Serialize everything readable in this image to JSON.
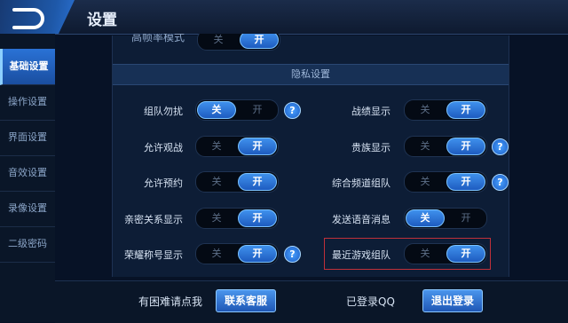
{
  "header": {
    "title": "设置"
  },
  "sidebar": {
    "items": [
      {
        "label": "基础设置",
        "active": true
      },
      {
        "label": "操作设置",
        "active": false
      },
      {
        "label": "界面设置",
        "active": false
      },
      {
        "label": "音效设置",
        "active": false
      },
      {
        "label": "录像设置",
        "active": false
      },
      {
        "label": "二级密码",
        "active": false
      }
    ]
  },
  "partial_row": {
    "label": "高帧率模式",
    "off": "关",
    "on": "开",
    "state": "on"
  },
  "section": {
    "title": "隐私设置"
  },
  "settings": {
    "left": [
      {
        "label": "组队勿扰",
        "off": "关",
        "on": "开",
        "state": "off",
        "help": "?"
      },
      {
        "label": "允许观战",
        "off": "关",
        "on": "开",
        "state": "on"
      },
      {
        "label": "允许预约",
        "off": "关",
        "on": "开",
        "state": "on"
      },
      {
        "label": "亲密关系显示",
        "off": "关",
        "on": "开",
        "state": "on"
      },
      {
        "label": "荣耀称号显示",
        "off": "关",
        "on": "开",
        "state": "on",
        "help": "?"
      }
    ],
    "right": [
      {
        "label": "战绩显示",
        "off": "关",
        "on": "开",
        "state": "on"
      },
      {
        "label": "贵族显示",
        "off": "关",
        "on": "开",
        "state": "on",
        "help": "?"
      },
      {
        "label": "综合频道组队",
        "off": "关",
        "on": "开",
        "state": "on",
        "help": "?"
      },
      {
        "label": "发送语音消息",
        "off": "关",
        "on": "开",
        "state": "off"
      },
      {
        "label": "最近游戏组队",
        "off": "关",
        "on": "开",
        "state": "on"
      }
    ]
  },
  "footer": {
    "help_text": "有困难请点我",
    "contact_button": "联系客服",
    "login_status": "已登录QQ",
    "logout_button": "退出登录"
  },
  "colors": {
    "accent": "#2a72d6",
    "highlight": "#c0303a",
    "background": "#071226"
  }
}
